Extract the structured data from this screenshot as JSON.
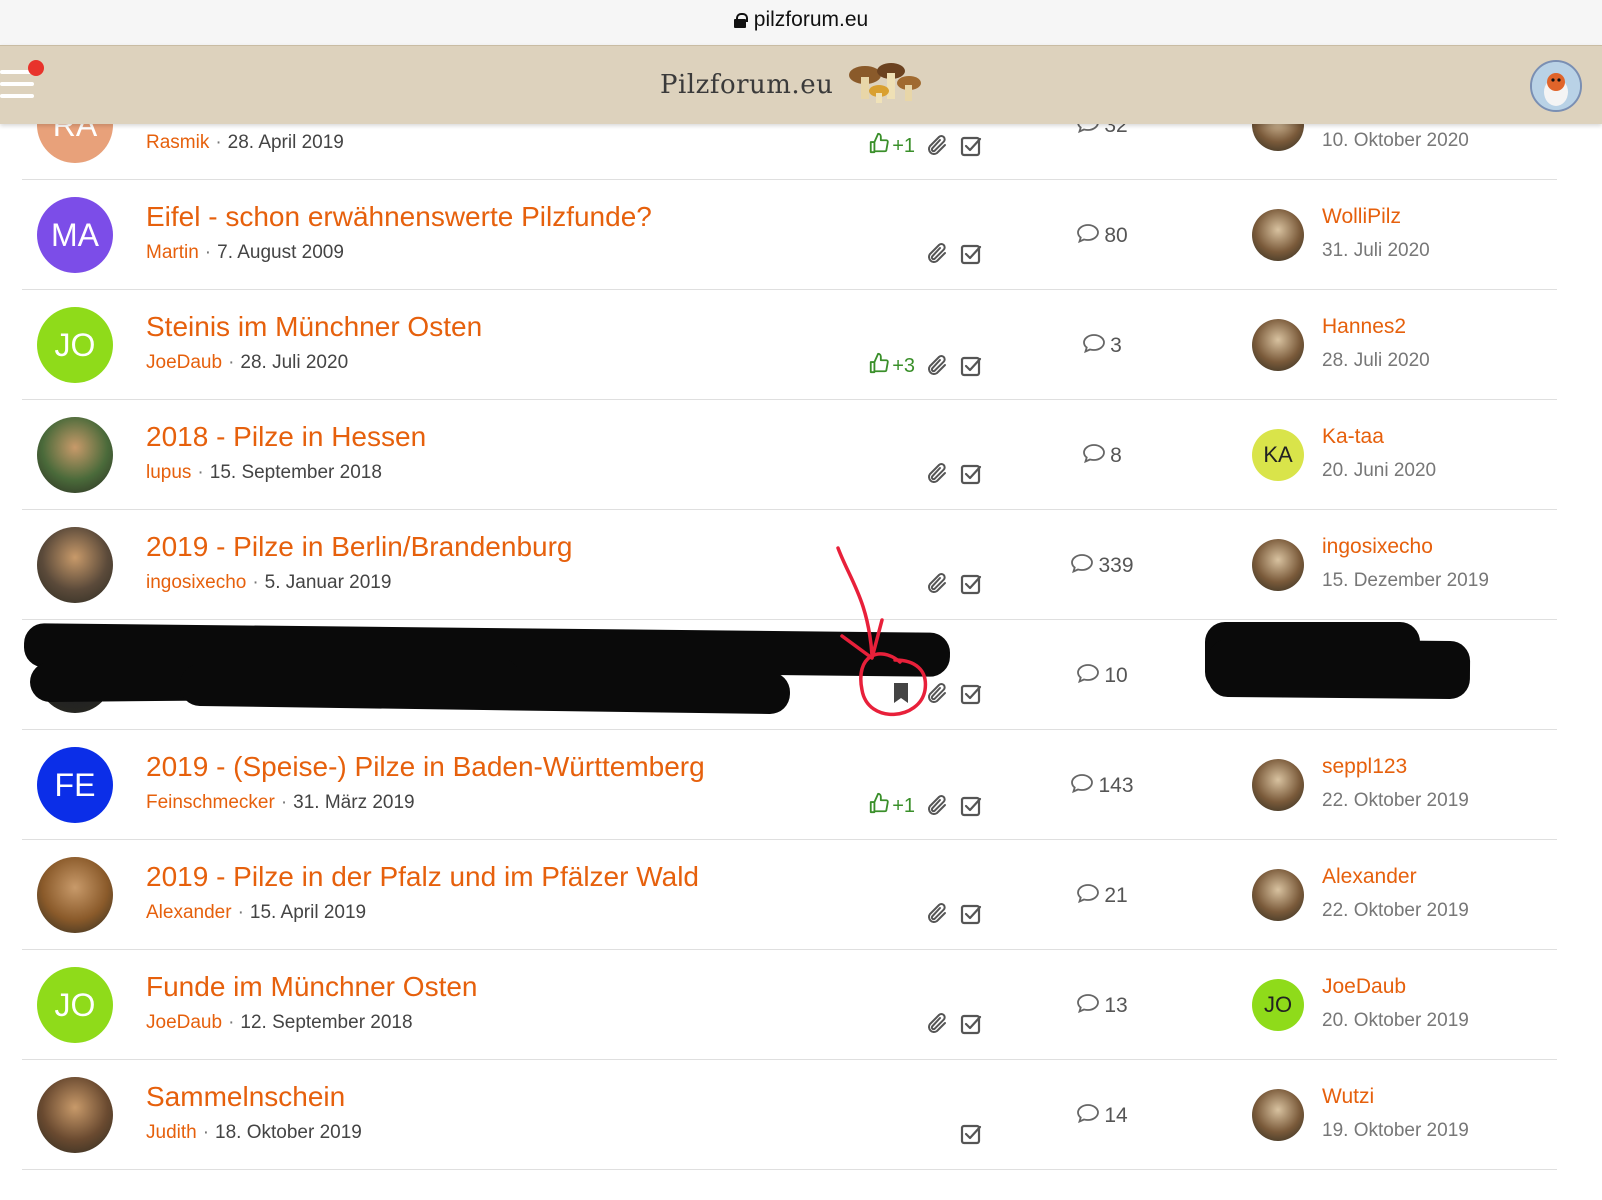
{
  "browser": {
    "url": "pilzforum.eu"
  },
  "header": {
    "logo_text": "Pilzforum.eu"
  },
  "threads": [
    {
      "avatar_initials": "RA",
      "avatar_color": "#e8a17a",
      "title": "",
      "author": "Rasmik",
      "date": "28. April 2019",
      "likes": "+1",
      "attachment": true,
      "replies": "32",
      "last_user": "",
      "last_date": "10. Oktober 2020"
    },
    {
      "avatar_initials": "MA",
      "avatar_color": "#7c4de8",
      "title": "Eifel - schon erwähnenswerte Pilzfunde?",
      "author": "Martin",
      "date": "7. August 2009",
      "likes": "",
      "attachment": true,
      "replies": "80",
      "last_user": "WolliPilz",
      "last_date": "31. Juli 2020"
    },
    {
      "avatar_initials": "JO",
      "avatar_color": "#8fdb1a",
      "title": "Steinis im Münchner Osten",
      "author": "JoeDaub",
      "date": "28. Juli 2020",
      "likes": "+3",
      "attachment": true,
      "replies": "3",
      "last_user": "Hannes2",
      "last_date": "28. Juli 2020"
    },
    {
      "avatar_initials": "",
      "avatar_color": "#4a6a3a",
      "title": "2018 - Pilze in Hessen",
      "author": "lupus",
      "date": "15. September 2018",
      "likes": "",
      "attachment": true,
      "replies": "8",
      "last_user": "Ka-taa",
      "last_date": "20. Juni 2020",
      "last_avatar_initials": "KA",
      "last_avatar_color": "#d9e44a"
    },
    {
      "avatar_initials": "",
      "avatar_color": "#5b4a3a",
      "title": "2019 - Pilze in Berlin/Brandenburg",
      "author": "ingosixecho",
      "date": "5. Januar 2019",
      "likes": "",
      "attachment": true,
      "replies": "339",
      "last_user": "ingosixecho",
      "last_date": "15. Dezember 2019"
    },
    {
      "avatar_initials": "",
      "avatar_color": "#222222",
      "title": "",
      "author": "",
      "date": "",
      "likes": "",
      "attachment": true,
      "bookmark": true,
      "replies": "10",
      "last_user": "",
      "last_date": ""
    },
    {
      "avatar_initials": "FE",
      "avatar_color": "#0b2ee8",
      "title": "2019 - (Speise-) Pilze in Baden-Württemberg",
      "author": "Feinschmecker",
      "date": "31. März 2019",
      "likes": "+1",
      "attachment": true,
      "replies": "143",
      "last_user": "seppl123",
      "last_date": "22. Oktober 2019"
    },
    {
      "avatar_initials": "",
      "avatar_color": "#8a5a2a",
      "title": "2019 - Pilze in der Pfalz und im Pfälzer Wald",
      "author": "Alexander",
      "date": "15. April 2019",
      "likes": "",
      "attachment": true,
      "replies": "21",
      "last_user": "Alexander",
      "last_date": "22. Oktober 2019"
    },
    {
      "avatar_initials": "JO",
      "avatar_color": "#8fdb1a",
      "title": "Funde im Münchner Osten",
      "author": "JoeDaub",
      "date": "12. September 2018",
      "likes": "",
      "attachment": true,
      "replies": "13",
      "last_user": "JoeDaub",
      "last_date": "20. Oktober 2019",
      "last_avatar_initials": "JO",
      "last_avatar_color": "#8fdb1a"
    },
    {
      "avatar_initials": "",
      "avatar_color": "#6a4a30",
      "title": "Sammelnschein",
      "author": "Judith",
      "date": "18. Oktober 2019",
      "likes": "",
      "attachment": false,
      "replies": "14",
      "last_user": "Wutzi",
      "last_date": "19. Oktober 2019"
    }
  ],
  "colors": {
    "link": "#e6600c",
    "like": "#3a8f2a",
    "header_bg": "#ddd2bd",
    "annotation": "#e8203a"
  },
  "icons": [
    "lock-icon",
    "hamburger-icon",
    "thumbs-up-icon",
    "paperclip-icon",
    "checkbox-icon",
    "comment-icon",
    "bookmark-icon"
  ]
}
